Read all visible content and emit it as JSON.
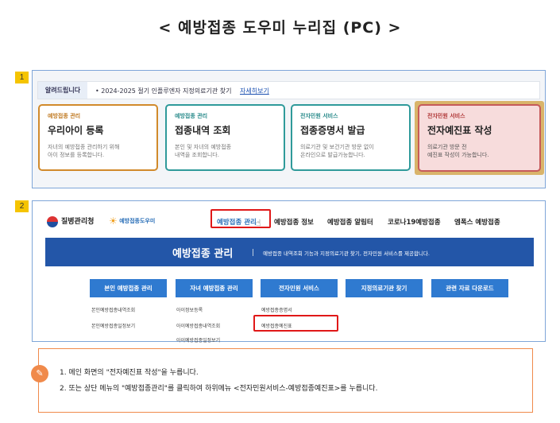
{
  "title": "< 예방접종 도우미 누리집 (PC) >",
  "steps": [
    "1",
    "2"
  ],
  "panel1": {
    "notice_tag": "알려드립니다",
    "notice_text": "• 2024-2025 절기 인플루엔자 지정의료기관 찾기",
    "notice_link": "자세히보기",
    "cards": [
      {
        "category": "예방접종 관리",
        "name": "우리아이 등록",
        "desc1": "자녀의 예방접종 관리하기 위해",
        "desc2": "아이 정보를 등록합니다."
      },
      {
        "category": "예방접종 관리",
        "name": "접종내역 조회",
        "desc1": "본인 및 자녀의 예방접종",
        "desc2": "내역을 조회합니다."
      },
      {
        "category": "전자민원 서비스",
        "name": "접종증명서 발급",
        "desc1": "의료기관 및 보건기관 방문 없이",
        "desc2": "온라인으로 발급가능합니다."
      },
      {
        "category": "전자민원 서비스",
        "name": "전자예진표 작성",
        "desc1": "의료기관 방문 전",
        "desc2": "예진표 작성이 가능합니다."
      }
    ]
  },
  "panel2": {
    "logo1": "질병관리청",
    "logo2": "예방접종도우미",
    "nav": [
      "예방접종 관리",
      "예방접종 정보",
      "예방접종 알림터",
      "코로나19예방접종",
      "엠폭스 예방접종"
    ],
    "banner_title": "예방접종 관리",
    "banner_desc": "예방접종 내역조회 기능과 지정의료기관 찾기, 전자민원 서비스를 제공합니다.",
    "menus": [
      "본인 예방접종 관리",
      "자녀 예방접종 관리",
      "전자민원 서비스",
      "지정의료기관 찾기",
      "관련 자료 다운로드"
    ],
    "sub1": [
      "본인예방접종내역조회",
      "본인예방접종일정보기"
    ],
    "sub2": [
      "아이정보등록",
      "아이예방접종내역조회",
      "아이예방접종일정보기"
    ],
    "sub3": [
      "예방접종증명서",
      "예방접종예진표"
    ]
  },
  "note": {
    "line1": "1.  메인 화면의 \"전자예진표 작성\"을 누릅니다.",
    "line2": "2.  또는 상단 메뉴의 \"예방접종관리\"를 클릭하여 하위메뉴 <전자민원서비스-예방접종예진표>를 누릅니다."
  },
  "colors": {
    "accent_blue": "#2356a8",
    "highlight_red": "#e01818",
    "badge": "#f5c400",
    "note_orange": "#f08a4b"
  }
}
